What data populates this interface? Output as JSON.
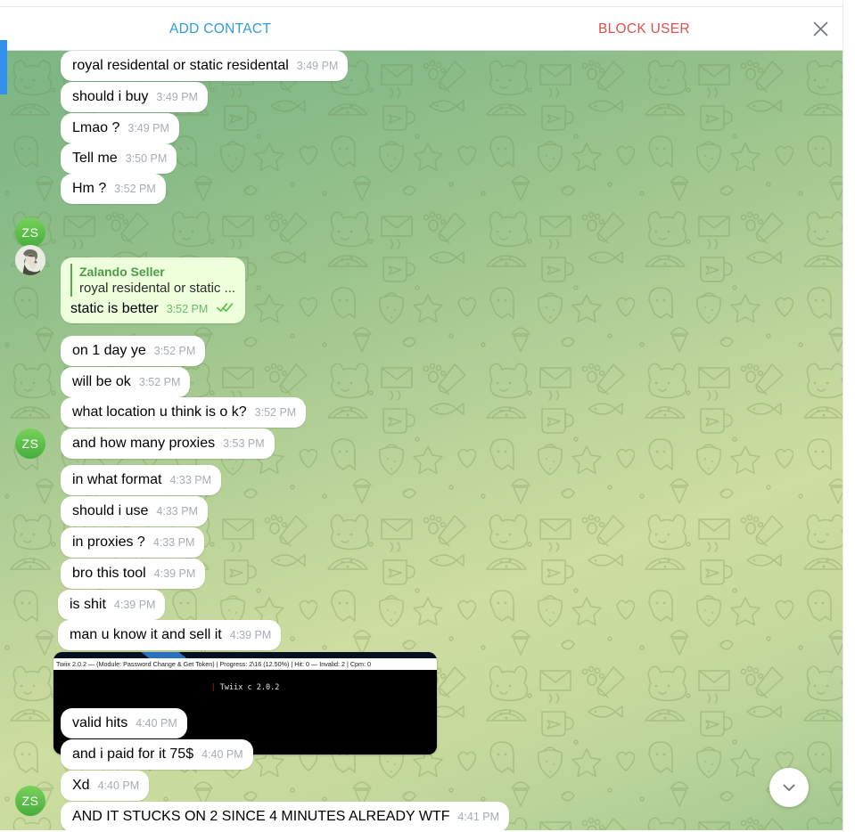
{
  "header": {
    "add_contact_label": "ADD CONTACT",
    "block_user_label": "BLOCK USER",
    "close_icon": "close-icon",
    "add_contact_color": "#2f9ae0",
    "block_user_color": "#dd5049"
  },
  "chat": {
    "background_type": "telegram-doodle-pattern",
    "background_colors": [
      "#7cb584",
      "#bcd49a",
      "#cedda0",
      "#a0c78f"
    ],
    "peer_initials": "ZS",
    "peer_name": "Zalando Seller",
    "messages": [
      {
        "id": 1,
        "dir": "in",
        "text": "royal residental or static residental",
        "time": "3:49 PM"
      },
      {
        "id": 2,
        "dir": "in",
        "text": "should i buy",
        "time": "3:49 PM"
      },
      {
        "id": 3,
        "dir": "in",
        "text": "Lmao ?",
        "time": "3:49 PM"
      },
      {
        "id": 4,
        "dir": "in",
        "text": "Tell me",
        "time": "3:50 PM"
      },
      {
        "id": 5,
        "dir": "in",
        "text": "Hm ?",
        "time": "3:52 PM",
        "avatar": "ZS"
      },
      {
        "id": 6,
        "dir": "out",
        "text": "static is better",
        "time": "3:52 PM",
        "status": "read",
        "reply": {
          "name": "Zalando Seller",
          "text": "royal residental or static ..."
        }
      },
      {
        "id": 7,
        "dir": "in",
        "text": "on 1 day ye",
        "time": "3:52 PM"
      },
      {
        "id": 8,
        "dir": "in",
        "text": "will be ok",
        "time": "3:52 PM"
      },
      {
        "id": 9,
        "dir": "in",
        "text": "what location u think is o k?",
        "time": "3:52 PM"
      },
      {
        "id": 10,
        "dir": "in",
        "text": "and how many proxies",
        "time": "3:53 PM",
        "avatar": "ZS"
      },
      {
        "id": 11,
        "dir": "in",
        "text": "in what format",
        "time": "4:33 PM"
      },
      {
        "id": 12,
        "dir": "in",
        "text": "should i use",
        "time": "4:33 PM"
      },
      {
        "id": 13,
        "dir": "in",
        "text": "in proxies ?",
        "time": "4:33 PM"
      },
      {
        "id": 14,
        "dir": "in",
        "text": "bro this tool",
        "time": "4:39 PM"
      },
      {
        "id": 15,
        "dir": "in",
        "text": "is shit",
        "time": "4:39 PM"
      },
      {
        "id": 16,
        "dir": "in",
        "text": "man u know it and sell it",
        "time": "4:39 PM"
      },
      {
        "id": 17,
        "dir": "in",
        "type": "image",
        "caption": ""
      },
      {
        "id": 18,
        "dir": "in",
        "text": "valid hits",
        "time": "4:40 PM"
      },
      {
        "id": 19,
        "dir": "in",
        "text": "and i paid for it 75$",
        "time": "4:40 PM"
      },
      {
        "id": 20,
        "dir": "in",
        "text": "Xd",
        "time": "4:40 PM"
      },
      {
        "id": 21,
        "dir": "in",
        "text": "AND IT STUCKS ON 2 SINCE 4 MINUTES ALREADY WTF",
        "time": "4:41 PM",
        "avatar": "ZS"
      }
    ]
  },
  "terminal_image": {
    "title_bar": "Twiix 2.0.2 — (Module: Password Change & Get Token) | Progress: 2\\16 (12.50%) | Hit: 0 — Invalid: 2 | Cpm: 0",
    "app_name": "Twiix 2.0.2",
    "module": "Password Change & Get Token",
    "progress": "2\\16 (12.50%)",
    "hits": "0",
    "invalid": "2",
    "cpm": "0",
    "body_line": "Twiix c 2.0.2",
    "cursor_glyph": "|",
    "cursor_color": "#c0202a"
  },
  "scroll_button": {
    "icon": "chevron-down-icon"
  }
}
